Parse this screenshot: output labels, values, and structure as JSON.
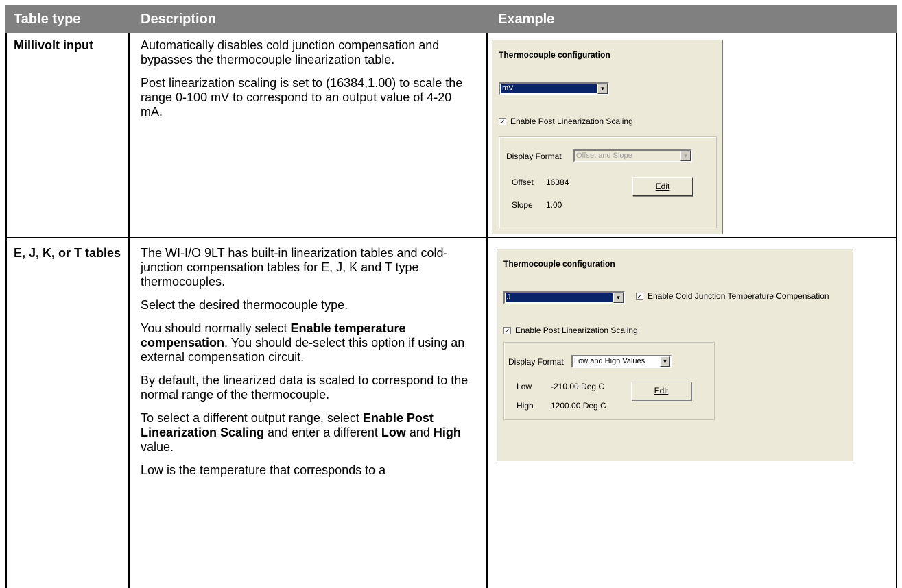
{
  "header": {
    "col1": "Table type",
    "col2": "Description",
    "col3": "Example"
  },
  "rows": [
    {
      "type": "Millivolt input",
      "desc": [
        "Automatically disables cold junction compensation and bypasses the thermocouple linearization table.",
        "Post linearization scaling is set to (16384,1.00) to scale the range 0-100 mV to correspond to an output value of 4-20 mA."
      ],
      "dialog": {
        "title": "Thermocouple configuration",
        "combo_value": "mV",
        "post_scaling_label": "Enable Post Linearization Scaling",
        "post_scaling_checked": true,
        "display_format_label": "Display Format",
        "display_format_value": "Offset and Slope",
        "field1_label": "Offset",
        "field1_value": "16384",
        "field2_label": "Slope",
        "field2_value": "1.00",
        "edit_label": "Edit"
      }
    },
    {
      "type": "E, J, K, or T tables",
      "desc": {
        "p1": "The WI-I/O 9LT has built-in linearization tables and cold-junction compensation tables for E, J, K and T type thermocouples.",
        "p2": "Select the desired thermocouple type.",
        "p3_pre": "You should normally select ",
        "p3_bold": "Enable temperature compensation",
        "p3_post": ". You should de-select this option if using an external compensation circuit.",
        "p4": "By default, the linearized data is scaled to correspond to the normal range of the thermocouple.",
        "p5_a": "To select a different output range, select ",
        "p5_b": "Enable Post Linearization Scaling",
        "p5_c": " and enter a different ",
        "p5_d": "Low",
        "p5_e": " and ",
        "p5_f": "High",
        "p5_g": " value.",
        "p6": "Low is the temperature that corresponds to a"
      },
      "dialog": {
        "title": "Thermocouple configuration",
        "combo_value": "J",
        "cold_junction_label": "Enable Cold Junction Temperature Compensation",
        "cold_junction_checked": true,
        "post_scaling_label": "Enable Post Linearization Scaling",
        "post_scaling_checked": true,
        "display_format_label": "Display Format",
        "display_format_value": "Low and High Values",
        "field1_label": "Low",
        "field1_value": "-210.00 Deg C",
        "field2_label": "High",
        "field2_value": "1200.00 Deg C",
        "edit_label": "Edit"
      }
    }
  ]
}
